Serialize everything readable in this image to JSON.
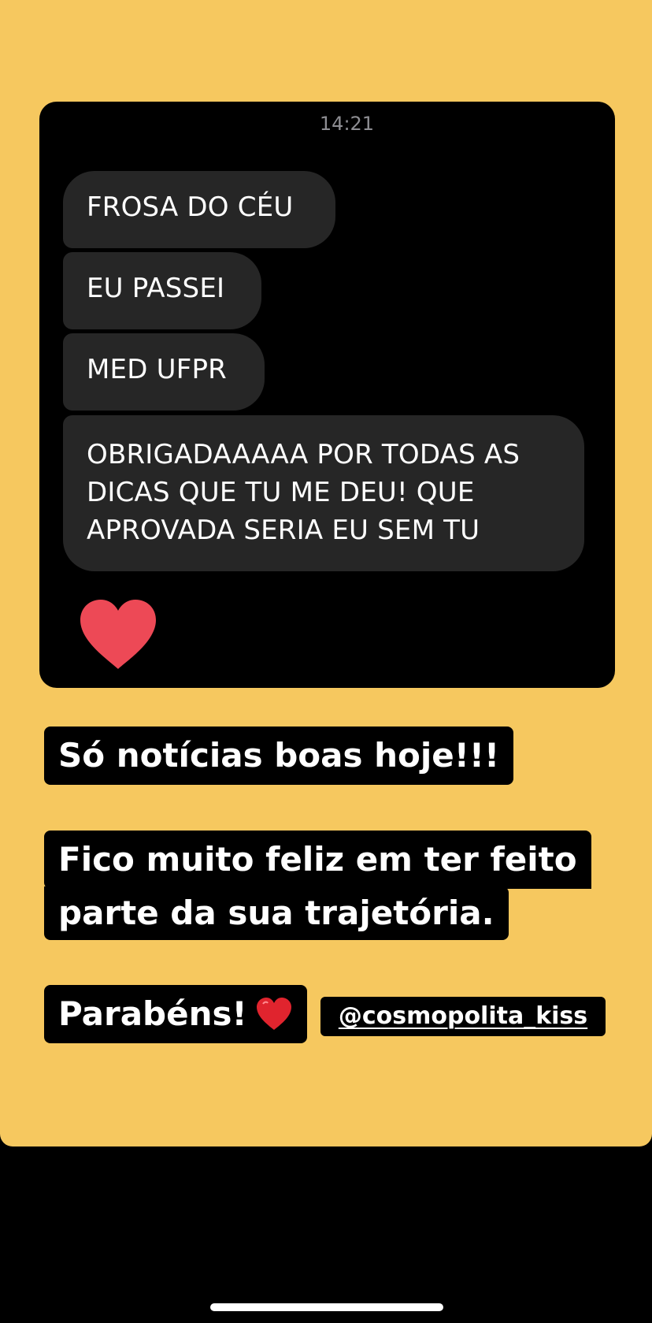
{
  "dm_screenshot": {
    "timestamp": "14:21",
    "messages": [
      "FROSA DO CÉU",
      "EU PASSEI",
      "MED UFPR",
      "OBRIGADAAAAA POR TODAS AS DICAS QUE TU ME DEU! QUE APROVADA SERIA EU SEM TU"
    ],
    "reaction_icon": "heart-icon"
  },
  "captions": {
    "line1": "Só notícias boas hoje!!!",
    "line2a": "Fico muito feliz em ter feito",
    "line2b": "parte da sua trajetória.",
    "line3": "Parabéns!",
    "line3_emoji": "heart-emoji-icon"
  },
  "mention": {
    "handle": "@cosmopolita_kiss"
  },
  "colors": {
    "background_yellow": "#f6c85f",
    "bubble_gray": "#262626",
    "heart_red": "#ed4956"
  }
}
